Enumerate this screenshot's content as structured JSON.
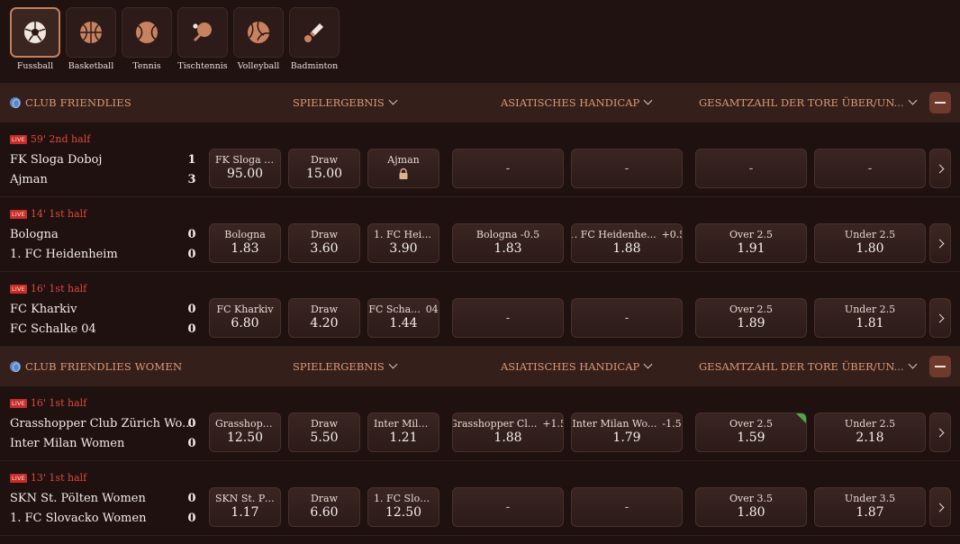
{
  "sports": [
    {
      "label": "Fussball",
      "icon": "soccer-ball-icon",
      "active": true
    },
    {
      "label": "Basketball",
      "icon": "basketball-icon",
      "active": false
    },
    {
      "label": "Tennis",
      "icon": "tennis-ball-icon",
      "active": false
    },
    {
      "label": "Tischtennis",
      "icon": "table-tennis-icon",
      "active": false
    },
    {
      "label": "Volleyball",
      "icon": "volleyball-icon",
      "active": false
    },
    {
      "label": "Badminton",
      "icon": "shuttlecock-icon",
      "active": false
    }
  ],
  "colors": {
    "accent": "#d99a72",
    "live": "#e0493f",
    "background": "#1e1110",
    "league_bar": "#351f1b"
  },
  "leagues": [
    {
      "name": "CLUB FRIENDLIES",
      "markets": [
        "SPIELERGEBNIS",
        "ASIATISCHES HANDICAP",
        "GESAMTZAHL DER TORE ÜBER/UN..."
      ],
      "matches": [
        {
          "live_badge": "LIVE",
          "time": "59' 2nd half",
          "team1": "FK Sloga Doboj",
          "team2": "Ajman",
          "score1": "1",
          "score2": "3",
          "odds": [
            {
              "label": "FK Sloga D...",
              "value": "95.00"
            },
            {
              "label": "Draw",
              "value": "15.00"
            },
            {
              "label": "Ajman",
              "value": "",
              "locked": true
            },
            {
              "dash": "-"
            },
            {
              "dash": "-"
            },
            {
              "dash": "-"
            },
            {
              "dash": "-"
            }
          ]
        },
        {
          "live_badge": "LIVE",
          "time": "14' 1st half",
          "team1": "Bologna",
          "team2": "1. FC Heidenheim",
          "score1": "0",
          "score2": "0",
          "odds": [
            {
              "label": "Bologna",
              "value": "1.83"
            },
            {
              "label": "Draw",
              "value": "3.60"
            },
            {
              "label": "1. FC Heid...",
              "value": "3.90"
            },
            {
              "label": "Bologna -0.5",
              "value": "1.83"
            },
            {
              "label": "1. FC Heidenhe...",
              "line": "+0.5",
              "value": "1.88"
            },
            {
              "label": "Over 2.5",
              "value": "1.91"
            },
            {
              "label": "Under 2.5",
              "value": "1.80"
            }
          ]
        },
        {
          "live_badge": "LIVE",
          "time": "16' 1st half",
          "team1": "FC Kharkiv",
          "team2": "FC Schalke 04",
          "score1": "0",
          "score2": "0",
          "odds": [
            {
              "label": "FC Kharkiv",
              "value": "6.80"
            },
            {
              "label": "Draw",
              "value": "4.20"
            },
            {
              "label": "FC Scha...",
              "line": "04",
              "value": "1.44"
            },
            {
              "dash": "-"
            },
            {
              "dash": "-"
            },
            {
              "label": "Over 2.5",
              "value": "1.89"
            },
            {
              "label": "Under 2.5",
              "value": "1.81"
            }
          ]
        }
      ]
    },
    {
      "name": "CLUB FRIENDLIES WOMEN",
      "markets": [
        "SPIELERGEBNIS",
        "ASIATISCHES HANDICAP",
        "GESAMTZAHL DER TORE ÜBER/UN..."
      ],
      "matches": [
        {
          "live_badge": "LIVE",
          "time": "16' 1st half",
          "team1": "Grasshopper Club Zürich Wo...",
          "team2": "Inter Milan Women",
          "score1": "0",
          "score2": "0",
          "odds": [
            {
              "label": "Grasshopp...",
              "value": "12.50"
            },
            {
              "label": "Draw",
              "value": "5.50"
            },
            {
              "label": "Inter Milan...",
              "value": "1.21"
            },
            {
              "label": "Grasshopper Cl...",
              "line": "+1.5",
              "value": "1.88"
            },
            {
              "label": "Inter Milan Wo...",
              "line": "-1.5",
              "value": "1.79"
            },
            {
              "label": "Over 2.5",
              "value": "1.59",
              "up": true
            },
            {
              "label": "Under 2.5",
              "value": "2.18"
            }
          ]
        },
        {
          "live_badge": "LIVE",
          "time": "13' 1st half",
          "team1": "SKN St. Pölten Women",
          "team2": "1. FC Slovacko Women",
          "score1": "0",
          "score2": "0",
          "odds": [
            {
              "label": "SKN St. Pö...",
              "value": "1.17"
            },
            {
              "label": "Draw",
              "value": "6.60"
            },
            {
              "label": "1. FC Slova...",
              "value": "12.50"
            },
            {
              "dash": "-"
            },
            {
              "dash": "-"
            },
            {
              "label": "Over 3.5",
              "value": "1.80"
            },
            {
              "label": "Under 3.5",
              "value": "1.87"
            }
          ]
        }
      ]
    }
  ]
}
